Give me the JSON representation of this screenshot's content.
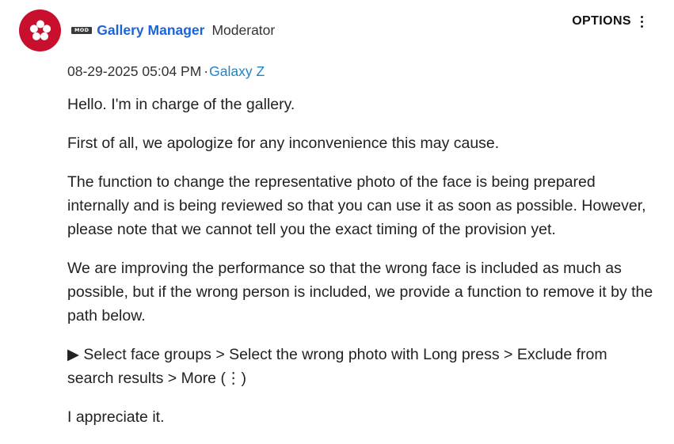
{
  "author": {
    "avatar_icon": "flower-icon",
    "avatar_color": "#c8102e",
    "badge": "MOD",
    "name": "Gallery Manager",
    "rank": "Moderator"
  },
  "options": {
    "label": "OPTIONS",
    "icon": "kebab-menu-icon"
  },
  "meta": {
    "datetime": "08-29-2025 05:04 PM",
    "separator": "·",
    "label": "Galaxy Z"
  },
  "body": {
    "paragraphs": [
      "Hello. I'm in charge of the gallery.",
      "First of all, we apologize for any inconvenience this may cause.",
      "The function to change the representative photo of the face is being prepared internally and is being reviewed so that you can use it as soon as possible. However, please note that we cannot tell you the exact timing of the provision yet.",
      "We are improving the performance so that the wrong face is included as much as possible, but if the wrong person is included, we provide a function to remove it by the path below.",
      "▶ Select face groups > Select the wrong photo with Long press > Exclude from search results > More (⋮)",
      "I appreciate it."
    ]
  },
  "colors": {
    "link": "#1a64d6",
    "label_link": "#1f83c8",
    "text": "#222222"
  }
}
